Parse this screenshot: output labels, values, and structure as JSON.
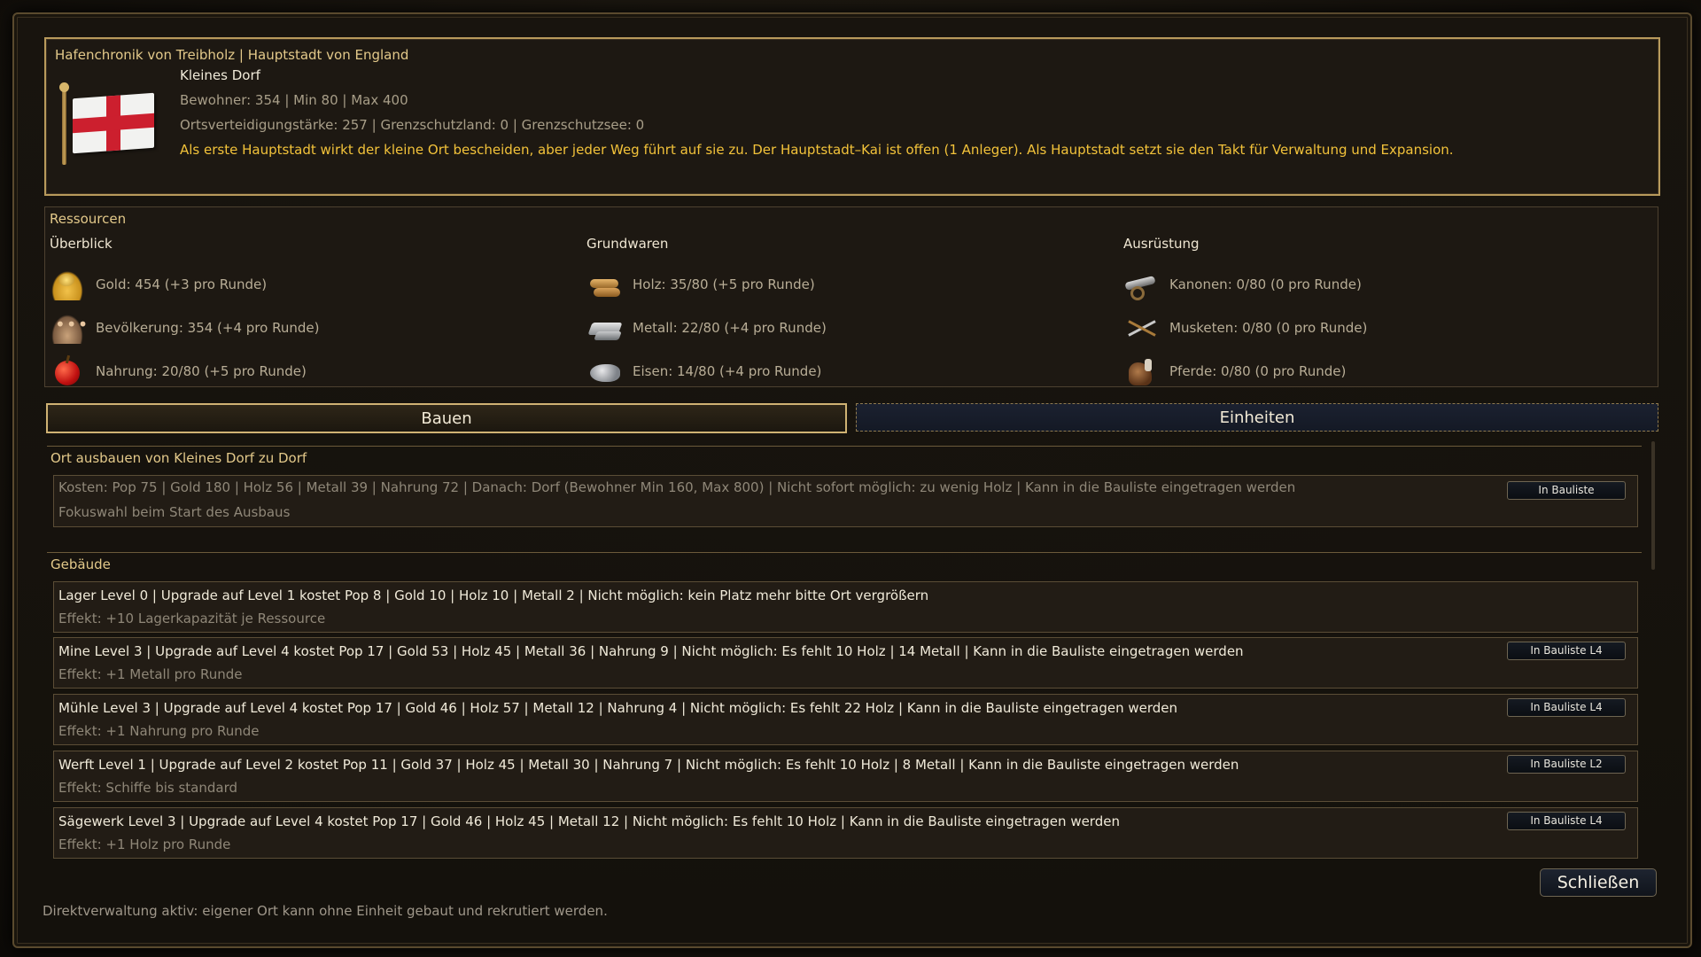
{
  "header": {
    "title": "Hafenchronik von Treibholz | Hauptstadt von England",
    "city_size": "Kleines Dorf",
    "population_line": "Bewohner: 354 | Min 80 | Max 400",
    "defense_line": "Ortsverteidigungstärke: 257 | Grenzschutzland: 0 | Grenzschutzsee: 0",
    "description": "Als erste Hauptstadt wirkt der kleine Ort bescheiden, aber jeder Weg führt auf sie zu. Der Hauptstadt–Kai ist offen (1 Anleger). Als Hauptstadt setzt sie den Takt für Verwaltung und Expansion."
  },
  "resources": {
    "title": "Ressourcen",
    "columns": [
      {
        "heading": "Überblick",
        "items": [
          {
            "icon": "gold-icon",
            "text": "Gold: 454 (+3 pro Runde)"
          },
          {
            "icon": "population-icon",
            "text": "Bevölkerung: 354 (+4 pro Runde)"
          },
          {
            "icon": "food-apple-icon",
            "text": "Nahrung: 20/80 (+5 pro Runde)"
          }
        ]
      },
      {
        "heading": "Grundwaren",
        "items": [
          {
            "icon": "wood-icon",
            "text": "Holz: 35/80 (+5 pro Runde)"
          },
          {
            "icon": "metal-icon",
            "text": "Metall: 22/80 (+4 pro Runde)"
          },
          {
            "icon": "iron-icon",
            "text": "Eisen: 14/80 (+4 pro Runde)"
          }
        ]
      },
      {
        "heading": "Ausrüstung",
        "items": [
          {
            "icon": "cannon-icon",
            "text": "Kanonen: 0/80 (0 pro Runde)"
          },
          {
            "icon": "musket-icon",
            "text": "Musketen: 0/80 (0 pro Runde)"
          },
          {
            "icon": "horse-icon",
            "text": "Pferde: 0/80 (0 pro Runde)"
          }
        ]
      }
    ]
  },
  "tabs": {
    "build": "Bauen",
    "units": "Einheiten"
  },
  "upgrade": {
    "title": "Ort ausbauen von Kleines Dorf zu Dorf",
    "costs": "Kosten: Pop 75 | Gold 180 | Holz 56 | Metall 39 | Nahrung 72 | Danach: Dorf (Bewohner Min 160, Max 800) | Nicht sofort möglich: zu wenig Holz | Kann in die Bauliste eingetragen werden",
    "focus": "Fokuswahl beim Start des Ausbaus",
    "button": "In Bauliste"
  },
  "buildings": {
    "title": "Gebäude",
    "items": [
      {
        "text": "Lager Level 0 | Upgrade auf Level 1 kostet Pop 8 | Gold 10 | Holz 10 | Metall 2 | Nicht möglich: kein Platz mehr bitte Ort vergrößern",
        "effect": "Effekt: +10 Lagerkapazität je Ressource",
        "button": ""
      },
      {
        "text": "Mine Level 3 | Upgrade auf Level 4 kostet Pop 17 | Gold 53 | Holz 45 | Metall 36 | Nahrung 9 | Nicht möglich: Es fehlt 10 Holz | 14 Metall | Kann in die Bauliste eingetragen werden",
        "effect": "Effekt: +1 Metall pro Runde",
        "button": "In Bauliste L4"
      },
      {
        "text": "Mühle Level 3 | Upgrade auf Level 4 kostet Pop 17 | Gold 46 | Holz 57 | Metall 12 | Nahrung 4 | Nicht möglich: Es fehlt 22 Holz | Kann in die Bauliste eingetragen werden",
        "effect": "Effekt: +1 Nahrung pro Runde",
        "button": "In Bauliste L4"
      },
      {
        "text": "Werft Level 1 | Upgrade auf Level 2 kostet Pop 11 | Gold 37 | Holz 45 | Metall 30 | Nahrung 7 | Nicht möglich: Es fehlt 10 Holz | 8 Metall | Kann in die Bauliste eingetragen werden",
        "effect": "Effekt: Schiffe bis standard",
        "button": "In Bauliste L2"
      },
      {
        "text": "Sägewerk Level 3 | Upgrade auf Level 4 kostet Pop 17 | Gold 46 | Holz 45 | Metall 12 | Nicht möglich: Es fehlt 10 Holz | Kann in die Bauliste eingetragen werden",
        "effect": "Effekt: +1 Holz pro Runde",
        "button": "In Bauliste L4"
      }
    ]
  },
  "footer": {
    "close": "Schließen",
    "status": "Direktverwaltung aktiv: eigener Ort kann ohne Einheit gebaut und rekrutiert werden."
  },
  "colors": {
    "accent_gold": "#e3c98a",
    "highlight_yellow": "#f2c23a",
    "flag_red": "#cc1f2e"
  }
}
